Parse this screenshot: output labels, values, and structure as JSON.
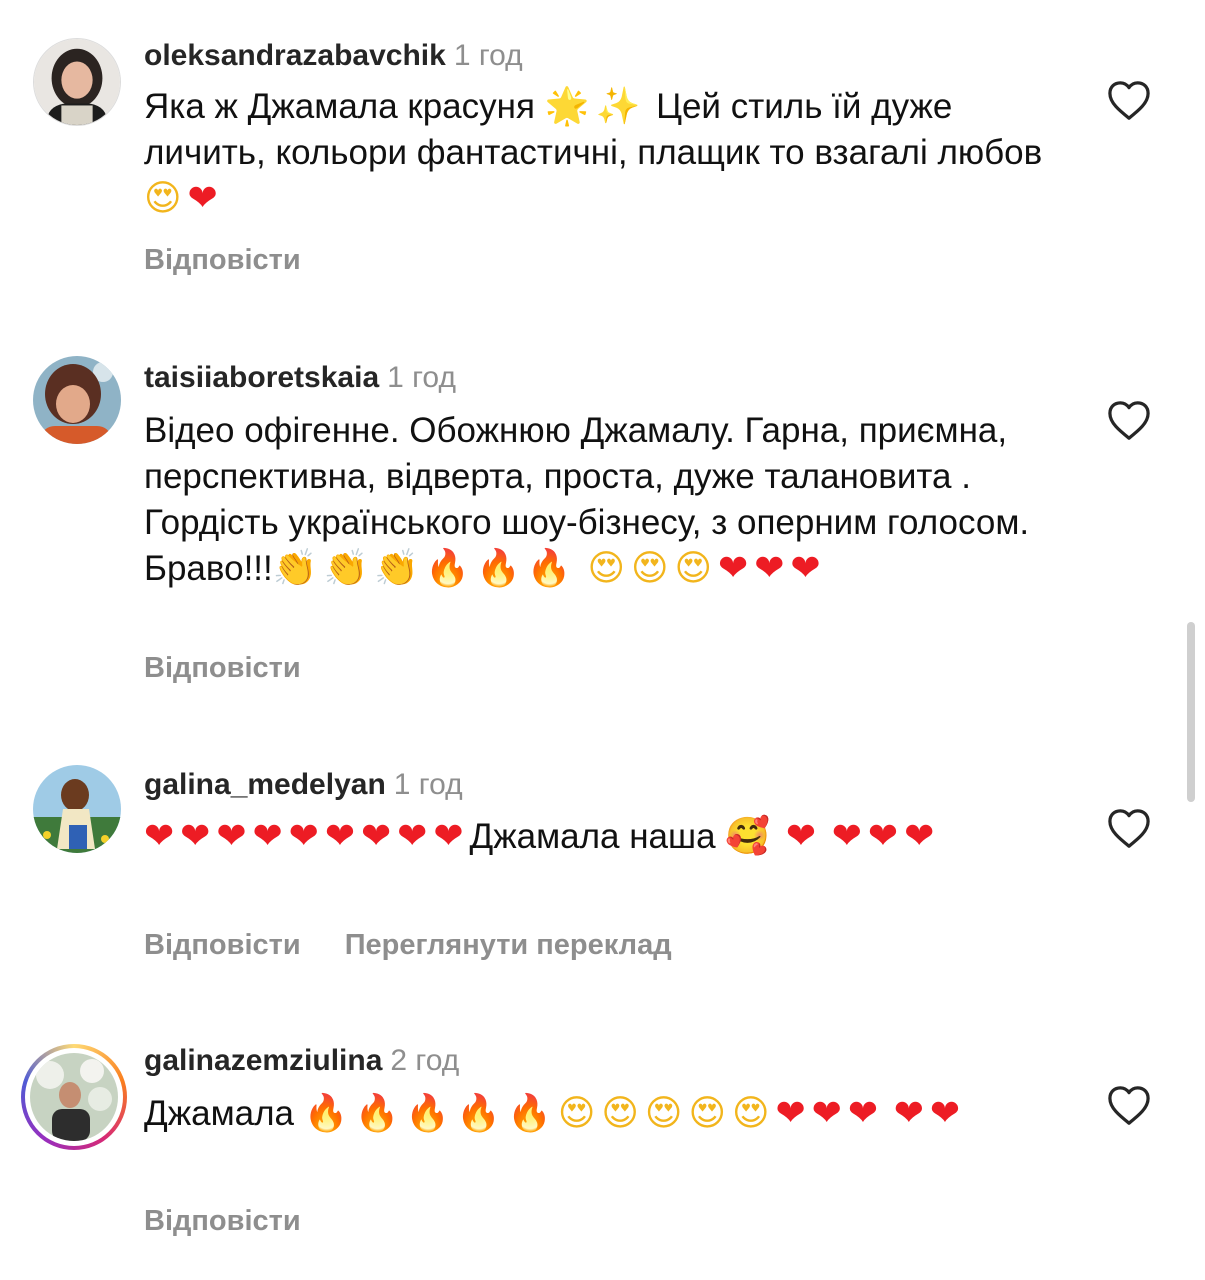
{
  "comments": [
    {
      "username": "oleksandrazabavchik",
      "time": "1 год",
      "text": "Яка ж Джамала красуня",
      "text_emoji_1": "🌟✨",
      "text_2": "Цей стиль їй дуже личить, кольори фантастичні, плащик то взагалі любов",
      "text_emoji_2": "😍",
      "text_emoji_3": "❤",
      "reply": "Відповісти"
    },
    {
      "username": "taisiiaboretskaia",
      "time": "1 год",
      "text": "Відео офігенне. Обожнюю Джамалу. Гарна, приємна, перспективна, відверта, проста, дуже талановита . Гордість українського шоу-бізнесу, з оперним голосом.  Браво!!!",
      "emoji_clap": "👏👏👏",
      "emoji_fire": "🔥🔥🔥",
      "emoji_face": "😍😍😍",
      "emoji_heart": "❤❤❤",
      "reply": "Відповісти"
    },
    {
      "username": "galina_medelyan",
      "time": "1 год",
      "emoji_heart_1": "❤❤❤❤❤❤❤❤❤",
      "text": "Джамала наша",
      "emoji_face": "🥰",
      "emoji_heart_2": "❤",
      "emoji_heart_3": "❤❤❤",
      "reply": "Відповісти",
      "translate": "Переглянути переклад"
    },
    {
      "username": "galinazemziulina",
      "time": "2 год",
      "text": "Джамала",
      "emoji_fire": "🔥🔥🔥🔥🔥",
      "emoji_face": "😍😍😍😍😍",
      "emoji_heart_1": "❤❤❤",
      "emoji_heart_2": "❤❤",
      "reply": "Відповісти"
    }
  ],
  "icons": {
    "like": "heart-outline-icon"
  },
  "colors": {
    "username": "#262626",
    "meta": "#8e8e8e",
    "heart": "#ed1c24",
    "story_ring": "#d62976"
  }
}
